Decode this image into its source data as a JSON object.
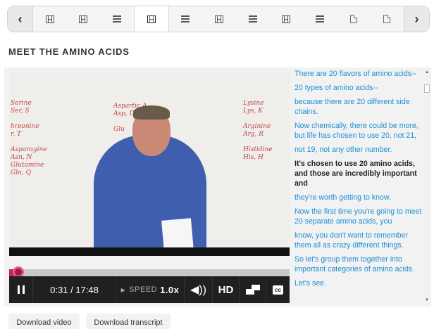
{
  "sequence_nav": {
    "prev_label": "‹",
    "next_label": "›",
    "items": [
      {
        "icon": "video-icon",
        "active": false
      },
      {
        "icon": "video-icon",
        "active": false
      },
      {
        "icon": "problem-icon",
        "active": false
      },
      {
        "icon": "video-icon",
        "active": true
      },
      {
        "icon": "problem-icon",
        "active": false
      },
      {
        "icon": "video-icon",
        "active": false
      },
      {
        "icon": "problem-icon",
        "active": false
      },
      {
        "icon": "video-icon",
        "active": false
      },
      {
        "icon": "problem-icon",
        "active": false
      },
      {
        "icon": "document-icon",
        "active": false
      },
      {
        "icon": "document-icon",
        "active": false
      }
    ]
  },
  "unit": {
    "title": "MEET THE AMINO ACIDS"
  },
  "video": {
    "board_text": {
      "left": "Serine\nSer, S\n\nhreonine\nr, T\n\nAsparagine\nAsn, N\nGlutamine\nGln, Q",
      "middle": "Aspartic A\nAsp, D\n\nGlu",
      "right": "Lysine\nLys, K\n\nArginine\nArg, R\n\nHistidine\nHis, H"
    },
    "progress_fraction": 0.03,
    "time_display": "0:31 / 17:48",
    "speed_label": "SPEED",
    "speed_value": "1.0x",
    "hd_label": "HD",
    "cc_label": "cc",
    "colors": {
      "progress": "#c5264a",
      "controls_bg": "#202020"
    }
  },
  "transcript": {
    "lines": [
      {
        "text": "There are 20 flavors of amino acids--",
        "current": false
      },
      {
        "text": "20 types of amino acids--",
        "current": false
      },
      {
        "text": "because there are 20 different side chains.",
        "current": false
      },
      {
        "text": "Now chemically, there could be more, but life has chosen to use 20, not 21,",
        "current": false
      },
      {
        "text": "not 19, not any other number.",
        "current": false
      },
      {
        "text": "It's chosen to use 20 amino acids, and those are incredibly important and",
        "current": true
      },
      {
        "text": "they're worth getting to know.",
        "current": false
      },
      {
        "text": "Now the first time you're going to meet 20 separate amino acids, you",
        "current": false
      },
      {
        "text": "know, you don't want to remember them all as crazy different things.",
        "current": false
      },
      {
        "text": "So let's group them together into important categories of amino acids.",
        "current": false
      },
      {
        "text": "Let's see.",
        "current": false
      }
    ],
    "link_color": "#1b8fd5"
  },
  "downloads": {
    "video_label": "Download video",
    "transcript_label": "Download transcript"
  }
}
